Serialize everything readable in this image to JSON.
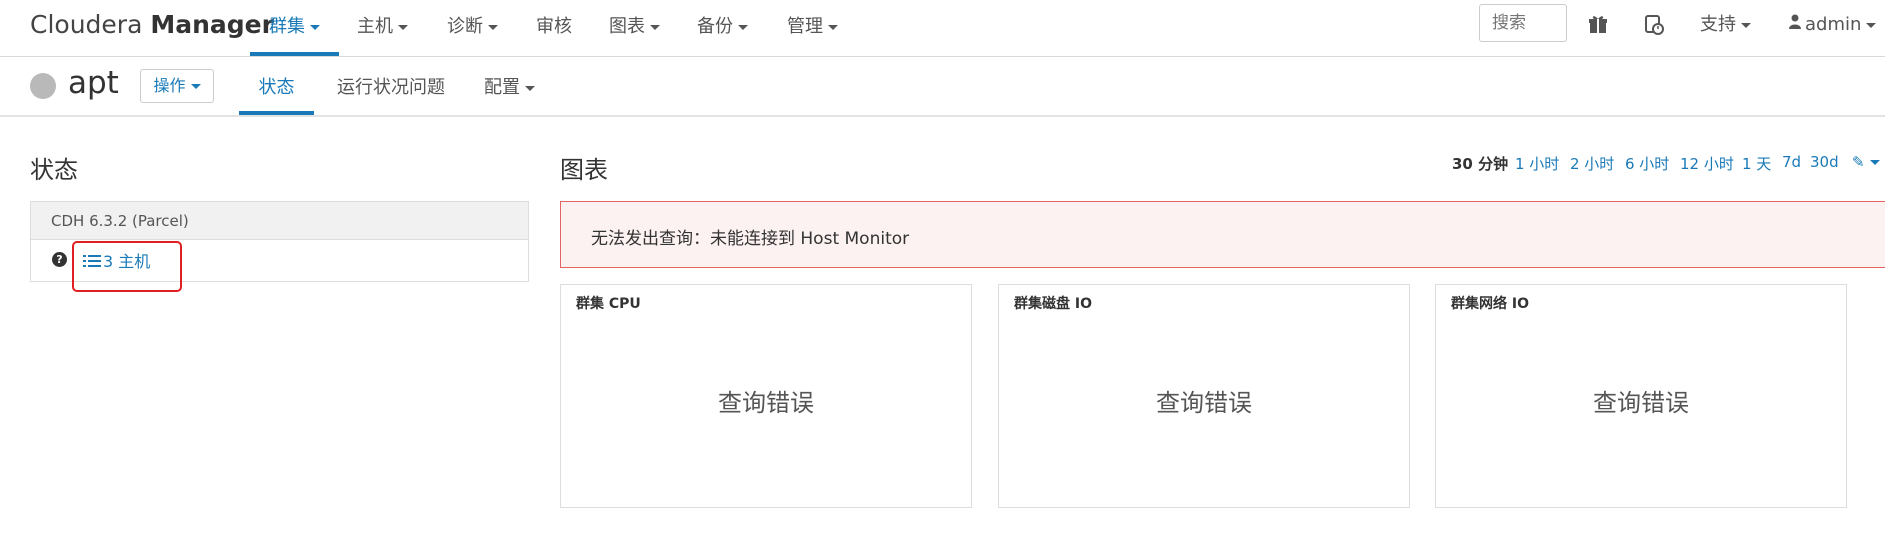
{
  "brand": {
    "light": "Cloudera ",
    "bold": "Manager"
  },
  "topnav": [
    {
      "label": "群集",
      "dropdown": true,
      "active": true
    },
    {
      "label": "主机",
      "dropdown": true
    },
    {
      "label": "诊断",
      "dropdown": true
    },
    {
      "label": "审核",
      "dropdown": false
    },
    {
      "label": "图表",
      "dropdown": true
    },
    {
      "label": "备份",
      "dropdown": true
    },
    {
      "label": "管理",
      "dropdown": true
    }
  ],
  "search": {
    "placeholder": "搜索"
  },
  "right_menu": {
    "support": "支持",
    "user": "admin"
  },
  "cluster": {
    "name": "apt",
    "actions_label": "操作"
  },
  "subtabs": [
    {
      "label": "状态",
      "active": true
    },
    {
      "label": "运行状况问题"
    },
    {
      "label": "配置",
      "dropdown": true
    }
  ],
  "status": {
    "heading": "状态",
    "version": "CDH 6.3.2 (Parcel)",
    "hosts_link": "3 主机"
  },
  "charts": {
    "heading": "图表",
    "time_ranges": [
      "30 分钟",
      "1 小时",
      "2 小时",
      "6 小时",
      "12 小时",
      "1 天",
      "7d",
      "30d"
    ],
    "selected_range": "30 分钟",
    "alert": "无法发出查询：未能连接到 Host Monitor",
    "panels": [
      {
        "title": "群集 CPU",
        "message": "查询错误"
      },
      {
        "title": "群集磁盘 IO",
        "message": "查询错误"
      },
      {
        "title": "群集网络 IO",
        "message": "查询错误"
      }
    ]
  },
  "colors": {
    "accent": "#1a7ab8",
    "alert_border": "#e46464",
    "alert_bg": "#fdf2f2",
    "highlight": "#e02020"
  }
}
